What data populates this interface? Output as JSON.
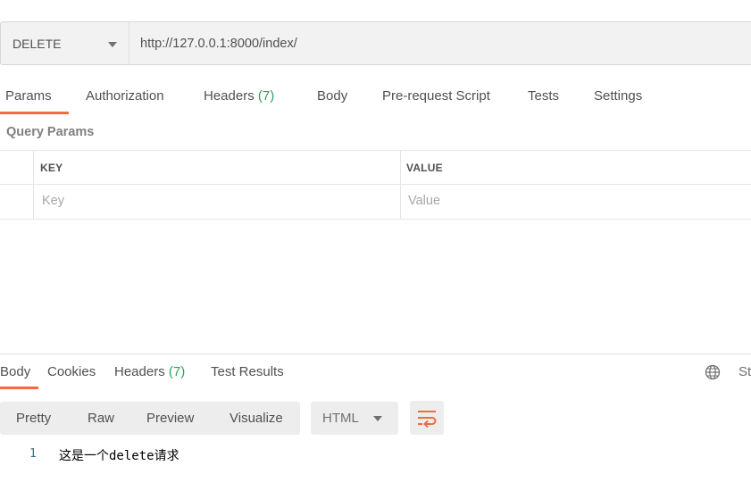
{
  "request": {
    "method": "DELETE",
    "url": "http://127.0.0.1:8000/index/"
  },
  "request_tabs": [
    {
      "label": "Params",
      "count": ""
    },
    {
      "label": "Authorization",
      "count": ""
    },
    {
      "label": "Headers",
      "count": "(7)"
    },
    {
      "label": "Body",
      "count": ""
    },
    {
      "label": "Pre-request Script",
      "count": ""
    },
    {
      "label": "Tests",
      "count": ""
    },
    {
      "label": "Settings",
      "count": ""
    }
  ],
  "params": {
    "title": "Query Params",
    "columns": {
      "key": "KEY",
      "value": "VALUE"
    },
    "placeholders": {
      "key": "Key",
      "value": "Value"
    }
  },
  "response_tabs": [
    {
      "label": "Body",
      "count": ""
    },
    {
      "label": "Cookies",
      "count": ""
    },
    {
      "label": "Headers",
      "count": "(7)"
    },
    {
      "label": "Test Results",
      "count": ""
    }
  ],
  "response_status_cut": "St",
  "view_modes": [
    "Pretty",
    "Raw",
    "Preview",
    "Visualize"
  ],
  "language": "HTML",
  "body_lines": [
    {
      "num": "1",
      "text": "这是一个delete请求"
    }
  ],
  "colors": {
    "accent": "#f26b3a",
    "count_green": "#26a55a"
  }
}
